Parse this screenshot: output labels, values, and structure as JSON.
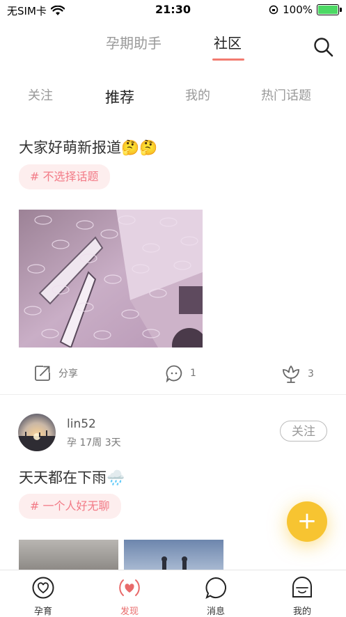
{
  "status_bar": {
    "carrier": "无SIM卡",
    "time": "21:30",
    "battery": "100%"
  },
  "top_tabs": [
    {
      "label": "孕期助手"
    },
    {
      "label": "社区"
    }
  ],
  "sub_tabs": [
    {
      "label": "关注"
    },
    {
      "label": "推荐"
    },
    {
      "label": "我的"
    },
    {
      "label": "热门话题"
    }
  ],
  "posts": [
    {
      "text": "大家好萌新报道🤔🤔",
      "topic": "# 不选择话题",
      "share_label": "分享",
      "comment_count": "1",
      "like_count": "3"
    },
    {
      "username": "lin52",
      "subtitle": "孕 17周 3天",
      "follow_label": "关注",
      "text": "天天都在下雨🌧️",
      "topic": "# 一个人好无聊"
    }
  ],
  "fab": {
    "label": "+"
  },
  "bottom_nav": [
    {
      "label": "孕育"
    },
    {
      "label": "发现"
    },
    {
      "label": "消息"
    },
    {
      "label": "我的"
    }
  ],
  "colors": {
    "accent": "#f27a6f",
    "fab": "#f7c431",
    "chip_bg": "#fdeeee",
    "chip_text": "#f27a86"
  }
}
